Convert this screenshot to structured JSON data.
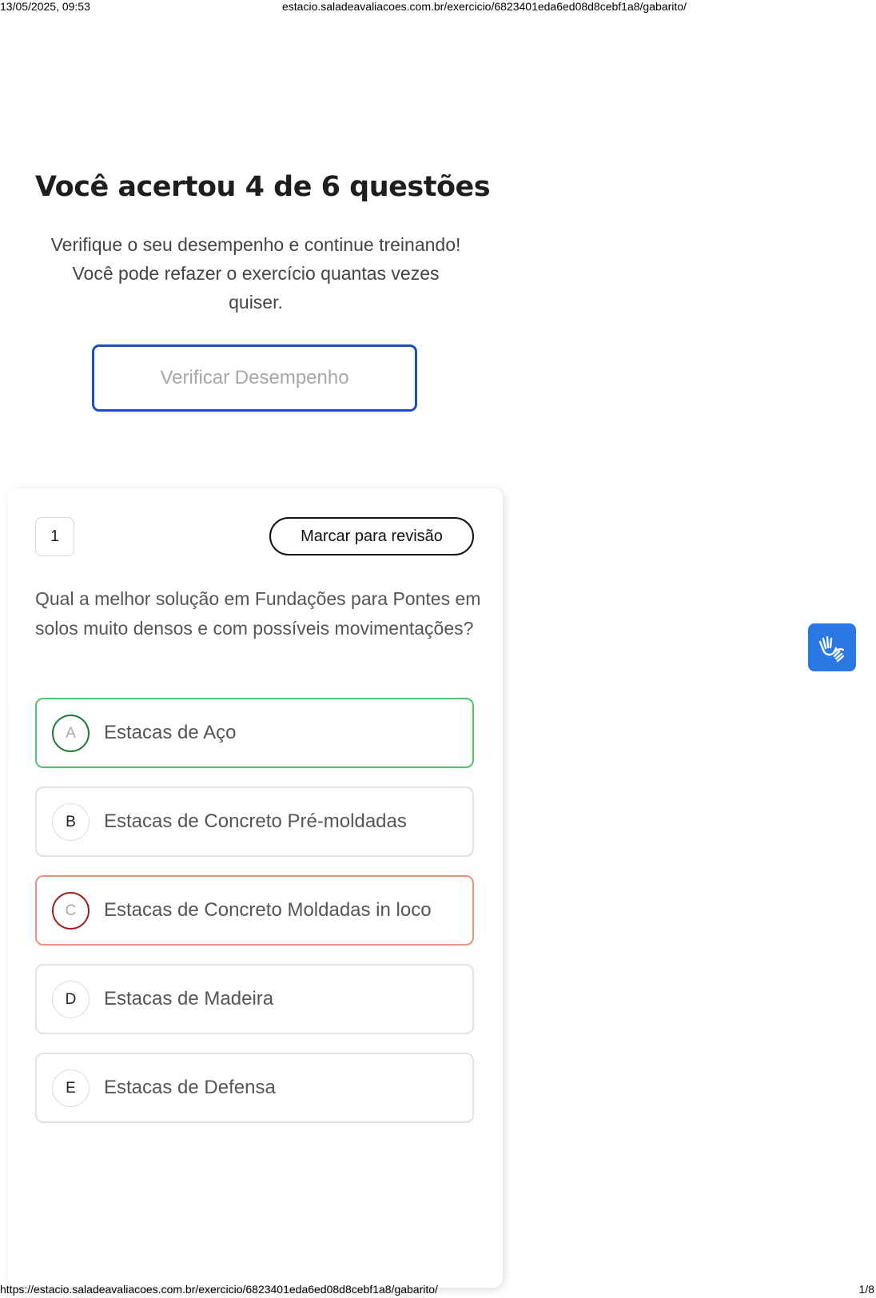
{
  "print_header": {
    "datetime": "13/05/2025, 09:53",
    "url": "estacio.saladeavaliacoes.com.br/exercicio/6823401eda6ed08d8cebf1a8/gabarito/"
  },
  "result": {
    "title": "Você acertou 4 de 6 questões",
    "description": "Verifique o seu desempenho e continue treinando! Você pode refazer o exercício quantas vezes quiser.",
    "button_label": "Verificar Desempenho"
  },
  "question": {
    "number": "1",
    "review_label": "Marcar para revisão",
    "text": "Qual a melhor solução em Fundações para Pontes em solos muito densos e com possíveis movimentações?",
    "options": [
      {
        "letter": "A",
        "label": "Estacas de Aço",
        "status": "correct"
      },
      {
        "letter": "B",
        "label": "Estacas de Concreto Pré-moldadas",
        "status": "neutral"
      },
      {
        "letter": "C",
        "label": "Estacas de Concreto Moldadas in loco",
        "status": "wrong"
      },
      {
        "letter": "D",
        "label": "Estacas de Madeira",
        "status": "neutral"
      },
      {
        "letter": "E",
        "label": "Estacas de Defensa",
        "status": "neutral"
      }
    ]
  },
  "accessibility": {
    "icon": "sign-language-icon",
    "color": "#2a78e4"
  },
  "colors": {
    "accent": "#1a4fc4",
    "correct": "#4ec46d",
    "wrong": "#f0907c"
  },
  "print_footer": {
    "url": "https://estacio.saladeavaliacoes.com.br/exercicio/6823401eda6ed08d8cebf1a8/gabarito/",
    "page": "1/8"
  }
}
